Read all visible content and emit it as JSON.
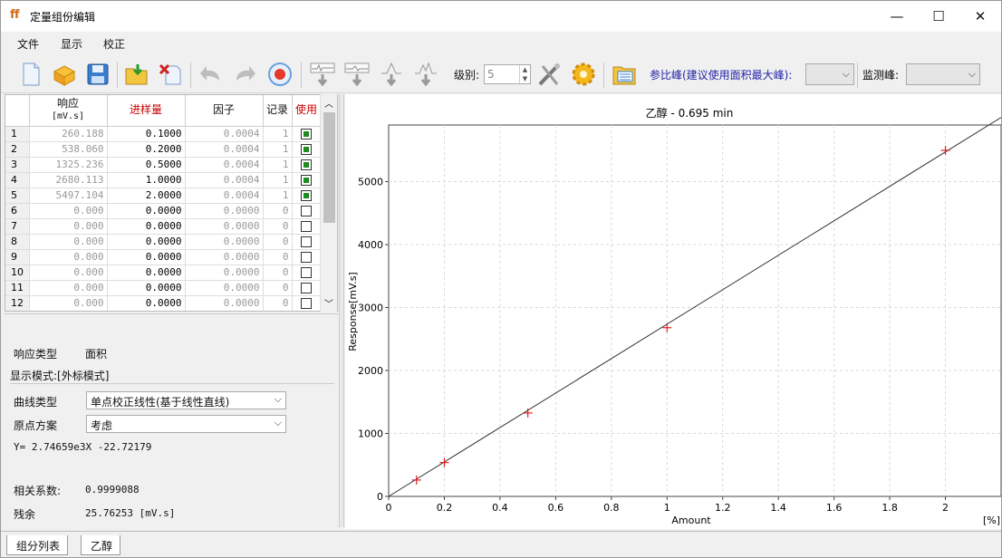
{
  "window": {
    "title": "定量组份编辑",
    "app_icon_glyph": "ff",
    "minimize": "—",
    "maximize": "☐",
    "close": "✕"
  },
  "menu": {
    "file": "文件",
    "view": "显示",
    "calibrate": "校正"
  },
  "toolbar": {
    "icons": [
      "new-doc-icon",
      "open-box-icon",
      "save-icon",
      "import-icon",
      "delete-icon",
      "undo-icon",
      "redo-icon",
      "record-icon",
      "peak-down-1-icon",
      "peak-down-2-icon",
      "peak-down-3-icon",
      "peak-down-4-icon"
    ],
    "level_label": "级别:",
    "level_value": "5",
    "ref_peak_label": "参比峰(建议使用面积最大峰):",
    "monitor_label": "监测峰:"
  },
  "grid": {
    "headers": {
      "response": "响应",
      "response_unit": "[mV.s]",
      "amount": "进样量",
      "factor": "因子",
      "record": "记录",
      "use": "使用"
    },
    "rows": [
      {
        "n": "1",
        "resp": "260.188",
        "amt": "0.1000",
        "factor": "0.0004",
        "rec": "1",
        "use": true
      },
      {
        "n": "2",
        "resp": "538.060",
        "amt": "0.2000",
        "factor": "0.0004",
        "rec": "1",
        "use": true
      },
      {
        "n": "3",
        "resp": "1325.236",
        "amt": "0.5000",
        "factor": "0.0004",
        "rec": "1",
        "use": true
      },
      {
        "n": "4",
        "resp": "2680.113",
        "amt": "1.0000",
        "factor": "0.0004",
        "rec": "1",
        "use": true
      },
      {
        "n": "5",
        "resp": "5497.104",
        "amt": "2.0000",
        "factor": "0.0004",
        "rec": "1",
        "use": true
      },
      {
        "n": "6",
        "resp": "0.000",
        "amt": "0.0000",
        "factor": "0.0000",
        "rec": "0",
        "use": false
      },
      {
        "n": "7",
        "resp": "0.000",
        "amt": "0.0000",
        "factor": "0.0000",
        "rec": "0",
        "use": false
      },
      {
        "n": "8",
        "resp": "0.000",
        "amt": "0.0000",
        "factor": "0.0000",
        "rec": "0",
        "use": false
      },
      {
        "n": "9",
        "resp": "0.000",
        "amt": "0.0000",
        "factor": "0.0000",
        "rec": "0",
        "use": false
      },
      {
        "n": "10",
        "resp": "0.000",
        "amt": "0.0000",
        "factor": "0.0000",
        "rec": "0",
        "use": false
      },
      {
        "n": "11",
        "resp": "0.000",
        "amt": "0.0000",
        "factor": "0.0000",
        "rec": "0",
        "use": false
      },
      {
        "n": "12",
        "resp": "0.000",
        "amt": "0.0000",
        "factor": "0.0000",
        "rec": "0",
        "use": false
      }
    ]
  },
  "info": {
    "response_type_label": "响应类型",
    "response_type_value": "面积",
    "display_mode": "显示模式:[外标模式]",
    "curve_type_label": "曲线类型",
    "curve_type_value": "单点校正线性(基于线性直线)",
    "origin_label": "原点方案",
    "origin_value": "考虑",
    "equation": "Y= 2.74659e3X -22.72179",
    "corr_label": "相关系数:",
    "corr_value": "0.9999088",
    "residual_label": "残余",
    "residual_value": "25.76253 [mV.s]"
  },
  "tabs": {
    "component_list": "组分列表",
    "ethanol": "乙醇"
  },
  "chart_data": {
    "type": "scatter",
    "title": "乙醇 - 0.695 min",
    "xlabel": "Amount",
    "ylabel": "Response[mV.s]",
    "x_unit": "[%]",
    "xlim": [
      0,
      2.2
    ],
    "ylim": [
      0,
      5900
    ],
    "xticks": [
      0,
      0.2,
      0.4,
      0.6,
      0.8,
      1,
      1.2,
      1.4,
      1.6,
      1.8,
      2
    ],
    "yticks": [
      0,
      1000,
      2000,
      3000,
      4000,
      5000
    ],
    "grid": true,
    "points": [
      {
        "x": 0.1,
        "y": 260.188
      },
      {
        "x": 0.2,
        "y": 538.06
      },
      {
        "x": 0.5,
        "y": 1325.236
      },
      {
        "x": 1.0,
        "y": 2680.113
      },
      {
        "x": 2.0,
        "y": 5497.104
      }
    ],
    "fit_line": {
      "slope": 2746.59,
      "intercept": -22.72179
    },
    "point_color": "#e02020",
    "line_color": "#333333"
  }
}
